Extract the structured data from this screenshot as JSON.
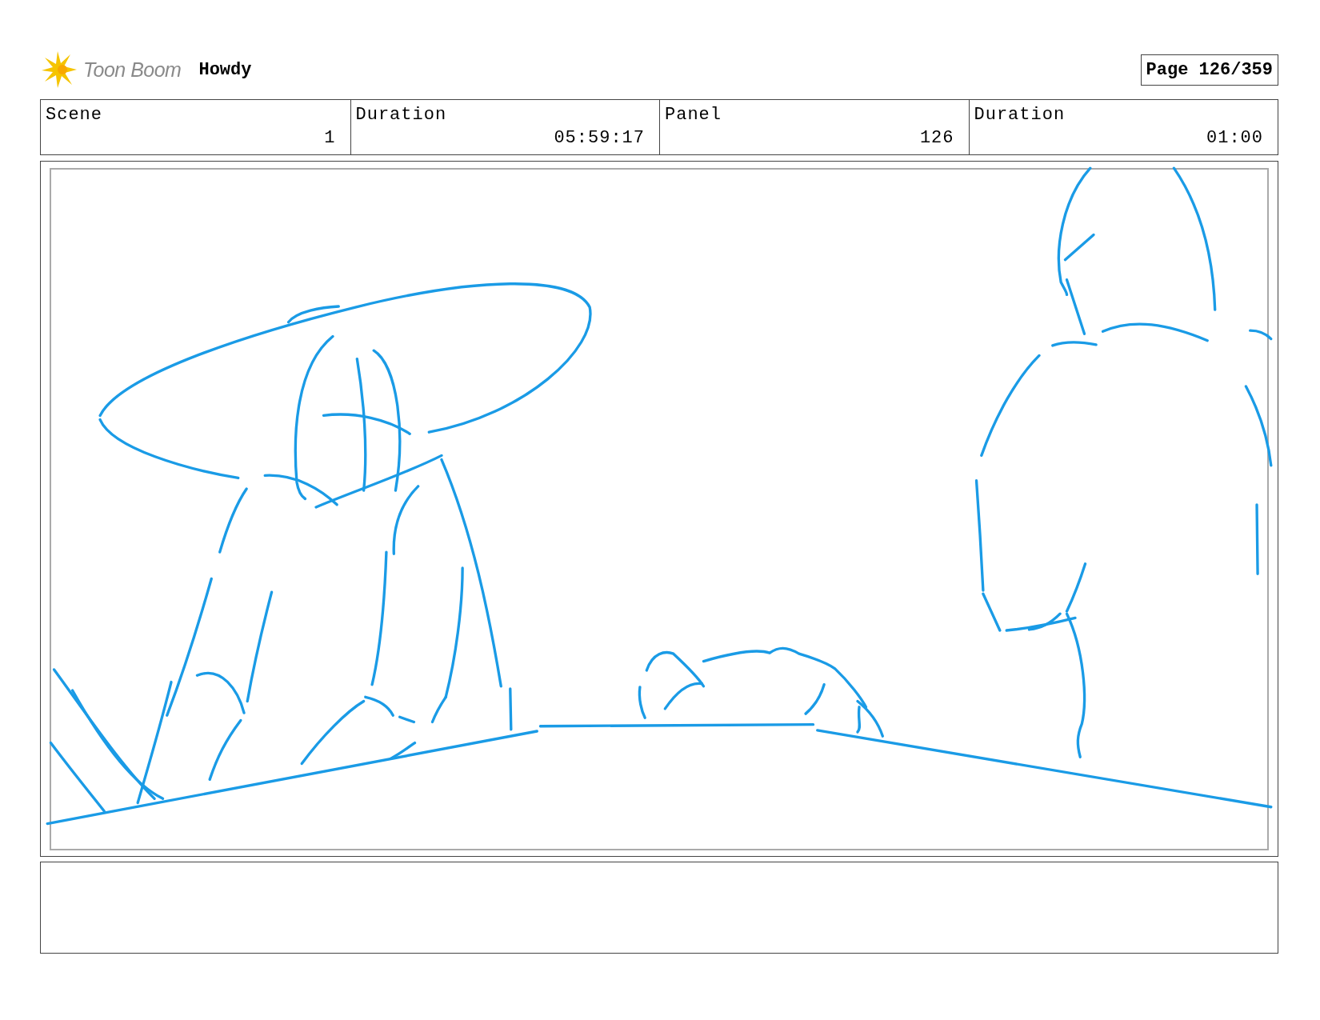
{
  "header": {
    "logo_text": "Toon Boom",
    "project": "Howdy",
    "page": "Page 126/359"
  },
  "fields": [
    {
      "label": "Scene",
      "value": "1"
    },
    {
      "label": "Duration",
      "value": "05:59:17"
    },
    {
      "label": "Panel",
      "value": "126"
    },
    {
      "label": "Duration",
      "value": "01:00"
    }
  ]
}
